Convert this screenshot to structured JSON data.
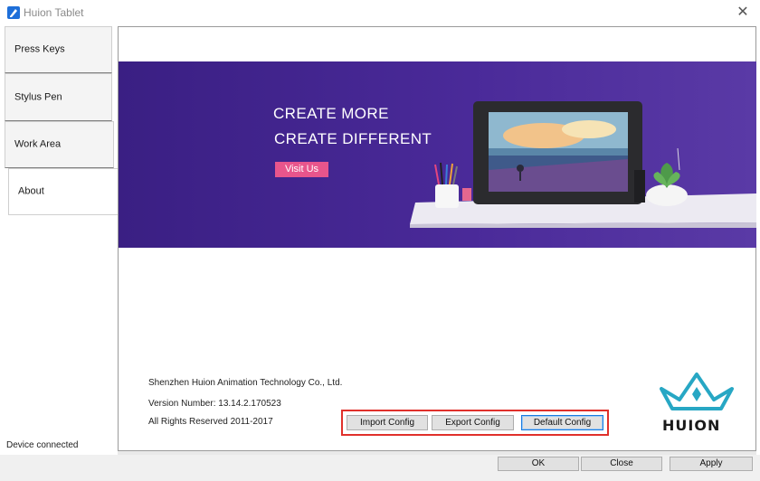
{
  "window": {
    "title": "Huion Tablet"
  },
  "tabs": [
    {
      "label": "Press Keys"
    },
    {
      "label": "Stylus Pen"
    },
    {
      "label": "Work Area"
    },
    {
      "label": "About"
    }
  ],
  "banner": {
    "headline_1": "CREATE MORE",
    "headline_2": "CREATE DIFFERENT",
    "visit_label": "Visit Us"
  },
  "about": {
    "company": "Shenzhen Huion Animation Technology Co., Ltd.",
    "version": "Version Number: 13.14.2.170523",
    "rights": "All Rights Reserved 2011-2017"
  },
  "config_buttons": {
    "import": "Import Config",
    "export": "Export Config",
    "default": "Default Config"
  },
  "logo": {
    "text": "HUION"
  },
  "status": "Device connected",
  "dialog": {
    "ok": "OK",
    "close": "Close",
    "apply": "Apply"
  },
  "colors": {
    "banner": "#4a2a99",
    "visit_button": "#e8558c",
    "highlight": "#e0302b",
    "logo_accent": "#27a7c4",
    "logo_text": "#1a1a1a"
  }
}
